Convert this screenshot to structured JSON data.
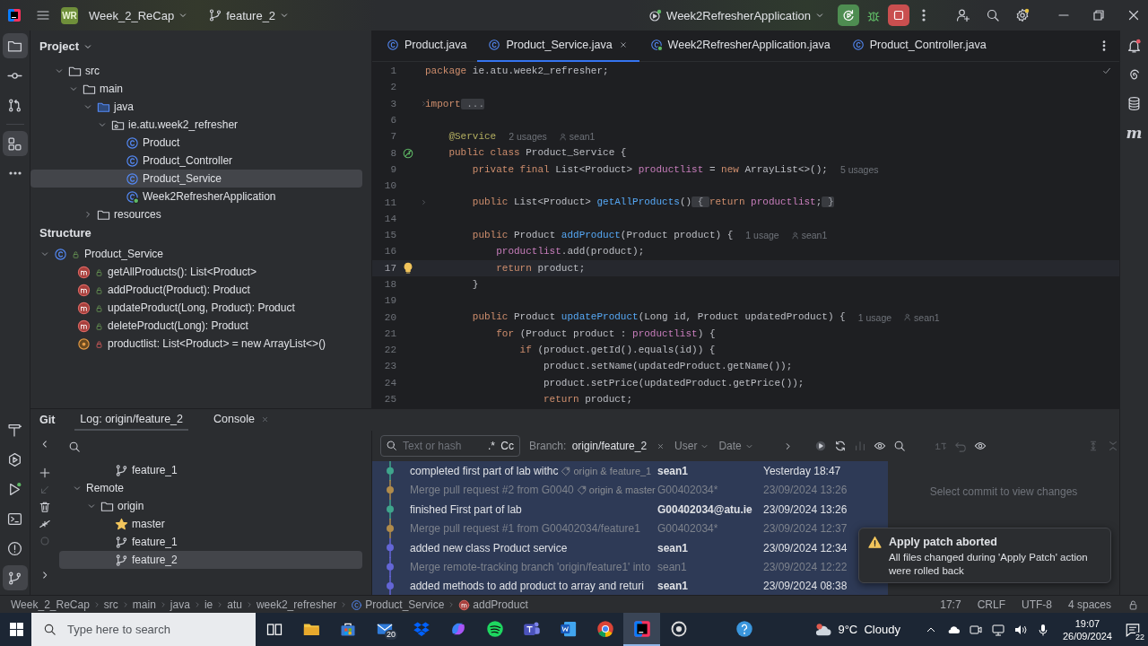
{
  "title_bar": {
    "project_badge": "WR",
    "project": "Week_2_ReCap",
    "branch": "feature_2",
    "run_config": "Week2RefresherApplication"
  },
  "tool_strip": {
    "top": [
      {
        "kind": "project",
        "selected": true
      },
      {
        "kind": "commit",
        "selected": false
      },
      {
        "kind": "pull_requests",
        "selected": false
      },
      {
        "kind": "structure",
        "selected": true
      },
      {
        "kind": "more",
        "selected": false
      }
    ],
    "bottom": [
      {
        "kind": "build",
        "selected": false
      },
      {
        "kind": "services",
        "selected": false
      },
      {
        "kind": "run",
        "selected": false
      },
      {
        "kind": "terminal",
        "selected": false
      },
      {
        "kind": "problems",
        "selected": false
      },
      {
        "kind": "git",
        "selected": true
      }
    ]
  },
  "project": {
    "title": "Project",
    "tree": [
      {
        "label": "src",
        "kind": "folder",
        "expanded": true,
        "selected": false,
        "children": [
          {
            "label": "main",
            "kind": "folder",
            "expanded": true,
            "selected": false,
            "children": [
              {
                "label": "java",
                "kind": "source_folder",
                "expanded": true,
                "selected": false,
                "children": [
                  {
                    "label": "ie.atu.week2_refresher",
                    "kind": "package",
                    "expanded": true,
                    "selected": false,
                    "children": [
                      {
                        "label": "Product",
                        "kind": "class",
                        "selected": false
                      },
                      {
                        "label": "Product_Controller",
                        "kind": "class",
                        "selected": false
                      },
                      {
                        "label": "Product_Service",
                        "kind": "class",
                        "selected": true
                      },
                      {
                        "label": "Week2RefresherApplication",
                        "kind": "spring_class",
                        "selected": false
                      }
                    ]
                  }
                ]
              },
              {
                "label": "resources",
                "kind": "folder",
                "expanded": false,
                "selected": false
              }
            ]
          }
        ]
      }
    ]
  },
  "structure": {
    "title": "Structure",
    "tree": [
      {
        "label": "Product_Service",
        "kind": "class",
        "expanded": true,
        "selected": false,
        "children": [
          {
            "label": "getAllProducts(): List<Product>",
            "kind": "method",
            "selected": false
          },
          {
            "label": "addProduct(Product): Product",
            "kind": "method",
            "selected": false
          },
          {
            "label": "updateProduct(Long, Product): Product",
            "kind": "method",
            "selected": false
          },
          {
            "label": "deleteProduct(Long): Product",
            "kind": "method",
            "selected": false
          },
          {
            "label": "productlist: List<Product> = new ArrayList<>()",
            "kind": "field",
            "selected": false
          }
        ]
      }
    ]
  },
  "editor": {
    "tabs": [
      {
        "label": "Product.java",
        "kind": "class",
        "selected": false
      },
      {
        "label": "Product_Service.java",
        "kind": "class",
        "selected": true
      },
      {
        "label": "Week2RefresherApplication.java",
        "kind": "spring_class",
        "selected": false
      },
      {
        "label": "Product_Controller.java",
        "kind": "class",
        "selected": false
      }
    ],
    "lines": [
      {
        "number": "1",
        "current": false,
        "tokens": [
          {
            "kind": "keyword",
            "text": "package"
          },
          {
            "kind": "plain",
            "text": " ie.atu.week2_refresher;"
          }
        ]
      },
      {
        "number": "2",
        "current": false
      },
      {
        "number": "3",
        "current": false,
        "gutter": {
          "kind": "fold"
        },
        "tokens": [
          {
            "kind": "keyword",
            "text": "import"
          },
          {
            "kind": "folded",
            "text": " ..."
          }
        ]
      },
      {
        "number": "6",
        "current": false
      },
      {
        "number": "7",
        "current": false,
        "tokens": [
          {
            "kind": "annotation",
            "text": "    @Service"
          }
        ],
        "hints": [
          {
            "kind": "usages",
            "text": "2 usages"
          },
          {
            "kind": "author",
            "text": "sean1"
          }
        ]
      },
      {
        "number": "8",
        "current": false,
        "gutter": {
          "kind": "bean"
        },
        "tokens": [
          {
            "kind": "keyword",
            "text": "    public class"
          },
          {
            "kind": "plain",
            "text": " Product_Service {"
          }
        ]
      },
      {
        "number": "9",
        "current": false,
        "tokens": [
          {
            "kind": "keyword",
            "text": "        private final"
          },
          {
            "kind": "plain",
            "text": " List<Product> "
          },
          {
            "kind": "field",
            "text": "productlist"
          },
          {
            "kind": "plain",
            "text": " = "
          },
          {
            "kind": "keyword",
            "text": "new"
          },
          {
            "kind": "plain",
            "text": " ArrayList<>();"
          }
        ],
        "hints": [
          {
            "kind": "usages",
            "text": "5 usages"
          }
        ]
      },
      {
        "number": "10",
        "current": false
      },
      {
        "number": "11",
        "current": false,
        "gutter": {
          "kind": "fold"
        },
        "tokens": [
          {
            "kind": "keyword",
            "text": "        public"
          },
          {
            "kind": "plain",
            "text": " List<Product> "
          },
          {
            "kind": "method",
            "text": "getAllProducts"
          },
          {
            "kind": "plain",
            "text": "()"
          },
          {
            "kind": "folded",
            "text": " { "
          },
          {
            "kind": "keyword",
            "text": "return"
          },
          {
            "kind": "field",
            "text": " productlist"
          },
          {
            "kind": "plain",
            "text": ";"
          },
          {
            "kind": "folded",
            "text": " }"
          }
        ]
      },
      {
        "number": "14",
        "current": false
      },
      {
        "number": "15",
        "current": false,
        "tokens": [
          {
            "kind": "keyword",
            "text": "        public"
          },
          {
            "kind": "plain",
            "text": " Product "
          },
          {
            "kind": "method",
            "text": "addProduct"
          },
          {
            "kind": "plain",
            "text": "(Product product) {"
          }
        ],
        "hints": [
          {
            "kind": "usages",
            "text": "1 usage"
          },
          {
            "kind": "author",
            "text": "sean1"
          }
        ]
      },
      {
        "number": "16",
        "current": false,
        "tokens": [
          {
            "kind": "field",
            "text": "            productlist"
          },
          {
            "kind": "plain",
            "text": ".add(product);"
          }
        ]
      },
      {
        "number": "17",
        "current": true,
        "gutter": {
          "kind": "bulb"
        },
        "tokens": [
          {
            "kind": "keyword",
            "text": "            return"
          },
          {
            "kind": "plain",
            "text": " product;"
          }
        ]
      },
      {
        "number": "18",
        "current": false,
        "tokens": [
          {
            "kind": "plain",
            "text": "        }"
          }
        ]
      },
      {
        "number": "19",
        "current": false
      },
      {
        "number": "20",
        "current": false,
        "tokens": [
          {
            "kind": "keyword",
            "text": "        public"
          },
          {
            "kind": "plain",
            "text": " Product "
          },
          {
            "kind": "method",
            "text": "updateProduct"
          },
          {
            "kind": "plain",
            "text": "(Long id, Product updatedProduct) {"
          }
        ],
        "hints": [
          {
            "kind": "usages",
            "text": "1 usage"
          },
          {
            "kind": "author",
            "text": "sean1"
          }
        ]
      },
      {
        "number": "21",
        "current": false,
        "tokens": [
          {
            "kind": "keyword",
            "text": "            for"
          },
          {
            "kind": "plain",
            "text": " (Product product : "
          },
          {
            "kind": "field",
            "text": "productlist"
          },
          {
            "kind": "plain",
            "text": ") {"
          }
        ]
      },
      {
        "number": "22",
        "current": false,
        "tokens": [
          {
            "kind": "keyword",
            "text": "                if"
          },
          {
            "kind": "plain",
            "text": " (product.getId().equals(id)) {"
          }
        ]
      },
      {
        "number": "23",
        "current": false,
        "tokens": [
          {
            "kind": "plain",
            "text": "                    product.setName(updatedProduct.getName());"
          }
        ]
      },
      {
        "number": "24",
        "current": false,
        "tokens": [
          {
            "kind": "plain",
            "text": "                    product.setPrice(updatedProduct.getPrice());"
          }
        ]
      },
      {
        "number": "25",
        "current": false,
        "tokens": [
          {
            "kind": "keyword",
            "text": "                    return"
          },
          {
            "kind": "plain",
            "text": " product;"
          }
        ]
      }
    ]
  },
  "right_strip": {
    "maven_label": "m"
  },
  "git": {
    "title": "Git",
    "tabs": [
      {
        "label": "Log: origin/feature_2",
        "selected": true
      },
      {
        "label": "Console",
        "selected": false
      }
    ],
    "branches": [
      {
        "label": "feature_1",
        "kind": "branch",
        "selected": false
      },
      {
        "label": "Remote",
        "kind": "group",
        "expanded": true,
        "selected": false,
        "children": [
          {
            "label": "origin",
            "kind": "folder",
            "expanded": true,
            "selected": false,
            "children": [
              {
                "label": "master",
                "kind": "favorite_branch",
                "selected": false
              },
              {
                "label": "feature_1",
                "kind": "branch",
                "selected": false
              },
              {
                "label": "feature_2",
                "kind": "branch",
                "selected": true
              }
            ]
          }
        ]
      }
    ],
    "filter": {
      "placeholder": "Text or hash",
      "regex": ".*",
      "match_case": "Cc",
      "branch_label": "Branch:",
      "branch": "origin/feature_2",
      "user": "User",
      "date": "Date"
    },
    "commits": [
      {
        "message": "completed first part of lab withc",
        "refs": "origin & feature_1",
        "author": "sean1",
        "date": "Yesterday 18:47",
        "dimmed": false,
        "color": "#3fa58c"
      },
      {
        "message": "Merge pull request #2 from G0040",
        "refs": "origin & master",
        "author": "G00402034*",
        "date": "23/09/2024 13:26",
        "dimmed": true,
        "color": "#b08b4b"
      },
      {
        "message": "finished First part of lab",
        "author": "G00402034@atu.ie",
        "date": "23/09/2024 13:26",
        "dimmed": false,
        "color": "#3fa58c"
      },
      {
        "message": "Merge pull request #1 from G00402034/feature1",
        "author": "G00402034*",
        "date": "23/09/2024 12:37",
        "dimmed": true,
        "color": "#b08b4b"
      },
      {
        "message": "added new class Product service",
        "author": "sean1",
        "date": "23/09/2024 12:34",
        "dimmed": false,
        "color": "#6466d6"
      },
      {
        "message": "Merge remote-tracking branch 'origin/feature1' into",
        "author": "sean1",
        "date": "23/09/2024 12:22",
        "dimmed": true,
        "color": "#6466d6"
      },
      {
        "message": "added methods to add product to array and returi",
        "author": "sean1",
        "date": "23/09/2024 08:38",
        "dimmed": false,
        "color": "#6466d6"
      }
    ],
    "details_hint": "Select commit to view changes",
    "notification": {
      "title": "Apply patch aborted",
      "message": "All files changed during 'Apply Patch' action were rolled back"
    }
  },
  "status_bar": {
    "breadcrumbs": [
      {
        "label": "Week_2_ReCap",
        "kind": "module"
      },
      {
        "label": "src",
        "kind": "folder"
      },
      {
        "label": "main",
        "kind": "folder"
      },
      {
        "label": "java",
        "kind": "folder"
      },
      {
        "label": "ie",
        "kind": "folder"
      },
      {
        "label": "atu",
        "kind": "folder"
      },
      {
        "label": "week2_refresher",
        "kind": "folder"
      },
      {
        "label": "Product_Service",
        "kind": "class"
      },
      {
        "label": "addProduct",
        "kind": "method"
      }
    ],
    "caret": "17:7",
    "line_separator": "CRLF",
    "encoding": "UTF-8",
    "indent": "4 spaces"
  },
  "taskbar": {
    "search_placeholder": "Type here to search",
    "apps": [
      {
        "kind": "task_view",
        "active": false
      },
      {
        "kind": "explorer",
        "active": false
      },
      {
        "kind": "store",
        "active": false
      },
      {
        "kind": "mail",
        "active": false,
        "badge": "20"
      },
      {
        "kind": "dropbox",
        "active": false
      },
      {
        "kind": "copilot",
        "active": false
      },
      {
        "kind": "spotify",
        "active": false
      },
      {
        "kind": "teams",
        "active": false
      },
      {
        "kind": "word",
        "active": false
      },
      {
        "kind": "chrome",
        "active": false
      },
      {
        "kind": "intellij",
        "active": true
      },
      {
        "kind": "recorder",
        "active": false
      },
      {
        "kind": "help",
        "active": false
      }
    ],
    "weather": {
      "temperature": "9°C",
      "condition": "Cloudy"
    },
    "time": "19:07",
    "date": "26/09/2024",
    "notifications": "22"
  }
}
